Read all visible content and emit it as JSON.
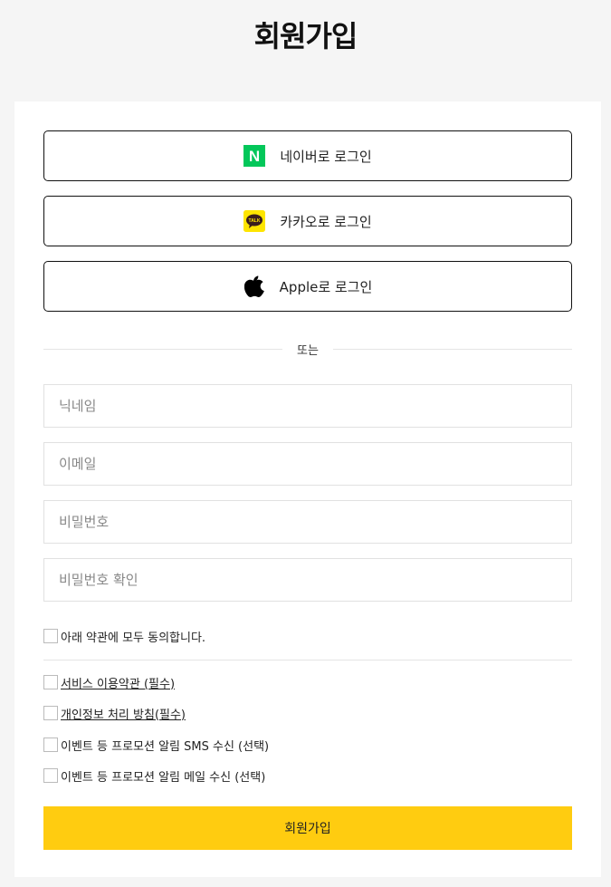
{
  "title": "회원가입",
  "social": {
    "naver": "네이버로 로그인",
    "naver_icon_letter": "N",
    "kakao": "카카오로 로그인",
    "kakao_icon_text": "TALK",
    "apple": "Apple로 로그인"
  },
  "divider": "또는",
  "fields": {
    "nickname": "닉네임",
    "email": "이메일",
    "password": "비밀번호",
    "password_confirm": "비밀번호 확인"
  },
  "agreements": {
    "all": "아래 약관에 모두 동의합니다.",
    "terms": "서비스 이용약관 (필수)",
    "privacy": "개인정보 처리 방침(필수)",
    "sms": "이벤트 등 프로모션 알림 SMS 수신 (선택)",
    "mail": "이벤트 등 프로모션 알림 메일 수신 (선택)"
  },
  "submit": "회원가입",
  "colors": {
    "accent": "#ffcc10",
    "naver": "#03c75a",
    "kakao": "#fee500"
  }
}
